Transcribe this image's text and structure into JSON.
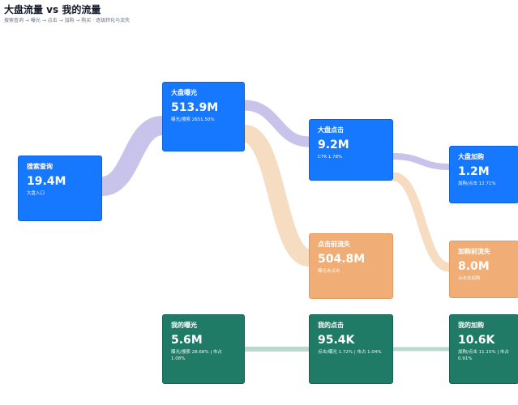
{
  "header": {
    "title": "大盘流量 vs 我的流量",
    "subtitle": "搜索查询 → 曝光 → 点击 → 加购 → 购买 · 逐级转化与流失"
  },
  "colors": {
    "node_blue": "#1677ff",
    "node_orange": "#f0ad75",
    "node_green": "#1f7a66",
    "flow_purple": "#c7c3ea",
    "flow_peach": "#f6dcc0",
    "flow_teal": "#b9d9cf"
  },
  "nodes": {
    "search": {
      "title": "搜索查询",
      "value": "19.4M",
      "note": "大盘入口"
    },
    "market_impression": {
      "title": "大盘曝光",
      "value": "513.9M",
      "note": "曝光/搜索 2651.50%"
    },
    "market_click": {
      "title": "大盘点击",
      "value": "9.2M",
      "note": "CTR 1.78%"
    },
    "market_cart": {
      "title": "大盘加购",
      "value": "1.2M",
      "note": "加购/点击 12.71%"
    },
    "loss_before_click": {
      "title": "点击前流失",
      "value": "504.8M",
      "note": "曝光未点击"
    },
    "loss_before_cart": {
      "title": "加购前流失",
      "value": "8.0M",
      "note": "点击未加购"
    },
    "my_impression": {
      "title": "我的曝光",
      "value": "5.6M",
      "note": "曝光/搜索 28.68% | 市占 1.08%"
    },
    "my_click": {
      "title": "我的点击",
      "value": "95.4K",
      "note": "点击/曝光 1.72% | 市占 1.04%"
    },
    "my_cart": {
      "title": "我的加购",
      "value": "10.6K",
      "note": "加购/点击 11.15% | 市占 0.91%"
    }
  }
}
